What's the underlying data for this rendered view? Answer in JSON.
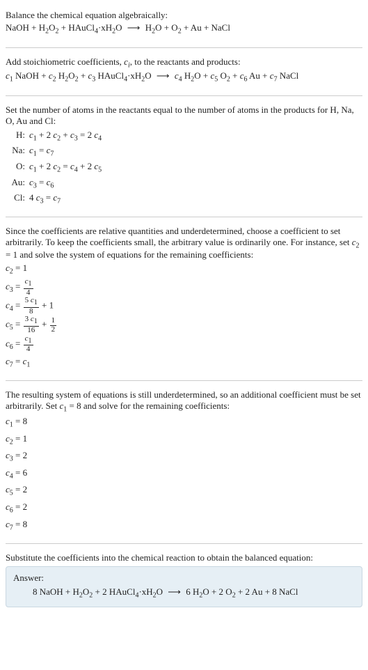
{
  "intro": {
    "prompt": "Balance the chemical equation algebraically:",
    "equation_lhs": "NaOH + H₂O₂ + HAuCl₄·xH₂O",
    "equation_rhs": "H₂O + O₂ + Au + NaCl"
  },
  "stoich": {
    "prompt_a": "Add stoichiometric coefficients, ",
    "ci": "c",
    "ci_sub": "i",
    "prompt_b": ", to the reactants and products:",
    "eq_lhs": "c₁ NaOH + c₂ H₂O₂ + c₃ HAuCl₄·xH₂O",
    "eq_rhs": "c₄ H₂O + c₅ O₂ + c₆ Au + c₇ NaCl"
  },
  "atoms": {
    "prompt": "Set the number of atoms in the reactants equal to the number of atoms in the products for H, Na, O, Au and Cl:",
    "rows": [
      {
        "el": "H:",
        "eq": "c₁ + 2 c₂ + c₃ = 2 c₄"
      },
      {
        "el": "Na:",
        "eq": "c₁ = c₇"
      },
      {
        "el": "O:",
        "eq": "c₁ + 2 c₂ = c₄ + 2 c₅"
      },
      {
        "el": "Au:",
        "eq": "c₃ = c₆"
      },
      {
        "el": "Cl:",
        "eq": "4 c₃ = c₇"
      }
    ]
  },
  "underdet1": {
    "text": "Since the coefficients are relative quantities and underdetermined, choose a coefficient to set arbitrarily. To keep the coefficients small, the arbitrary value is ordinarily one. For instance, set c₂ = 1 and solve the system of equations for the remaining coefficients:",
    "lines": {
      "l1": "c₂ = 1",
      "l2_lhs": "c₃ = ",
      "l2_num": "c₁",
      "l2_den": "4",
      "l3_lhs": "c₄ = ",
      "l3_num": "5 c₁",
      "l3_den": "8",
      "l3_tail": " + 1",
      "l4_lhs": "c₅ = ",
      "l4a_num": "3 c₁",
      "l4a_den": "16",
      "l4_mid": " + ",
      "l4b_num": "1",
      "l4b_den": "2",
      "l5_lhs": "c₆ = ",
      "l5_num": "c₁",
      "l5_den": "4",
      "l6": "c₇ = c₁"
    }
  },
  "underdet2": {
    "text": "The resulting system of equations is still underdetermined, so an additional coefficient must be set arbitrarily. Set c₁ = 8 and solve for the remaining coefficients:",
    "lines": [
      "c₁ = 8",
      "c₂ = 1",
      "c₃ = 2",
      "c₄ = 6",
      "c₅ = 2",
      "c₆ = 2",
      "c₇ = 8"
    ]
  },
  "final": {
    "prompt": "Substitute the coefficients into the chemical reaction to obtain the balanced equation:",
    "answer_label": "Answer:",
    "eq_lhs": "8 NaOH + H₂O₂ + 2 HAuCl₄·xH₂O",
    "eq_rhs": "6 H₂O + 2 O₂ + 2 Au + 8 NaCl"
  },
  "arrow": "⟶"
}
